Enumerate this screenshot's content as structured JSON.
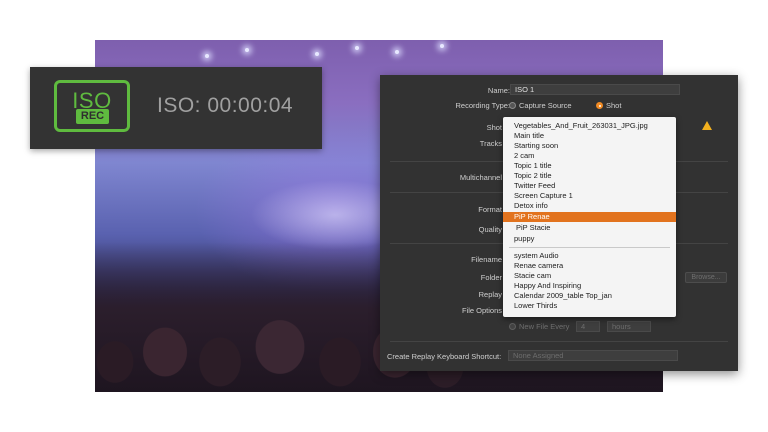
{
  "iso_panel": {
    "badge_text": "ISO",
    "rec_text": "REC",
    "timer": "ISO:  00:00:04"
  },
  "dialog": {
    "name_label": "Name:",
    "name_value": "ISO 1",
    "recording_type_label": "Recording Type:",
    "recording_options": [
      "Capture Source",
      "Shot"
    ],
    "recording_selected": "Shot",
    "shot_label": "Shot",
    "tracks_label": "Tracks",
    "multichannel_label": "Multichannel",
    "format_label": "Format",
    "quality_label": "Quality",
    "filename_label": "Filename",
    "folder_label": "Folder",
    "replay_label": "Replay",
    "file_options_label": "File Options",
    "browse_label": "Browse...",
    "new_file_every_label": "New File Every",
    "new_file_every_value": "4",
    "new_file_unit": "hours",
    "shortcut_label": "Create Replay Keyboard Shortcut:",
    "shortcut_value": "None Assigned"
  },
  "shot_dropdown": {
    "group1": [
      "Vegetables_And_Fruit_263031_JPG.jpg",
      "Main title",
      "Starting soon",
      "2 cam",
      "Topic 1 title",
      "Topic 2 title",
      "Twitter Feed",
      "Screen Capture 1",
      "Detox info",
      "PiP Renae",
      "PiP Stacie",
      "puppy"
    ],
    "selected": "PiP Renae",
    "group2": [
      "system Audio",
      "Renae camera",
      "Stacie cam",
      "Happy And Inspiring",
      "Calendar 2009_table Top_jan",
      "Lower Thirds"
    ]
  },
  "colors": {
    "accent_orange": "#e2731e",
    "iso_green": "#5fbb3f",
    "warning_yellow": "#f2b01e"
  }
}
